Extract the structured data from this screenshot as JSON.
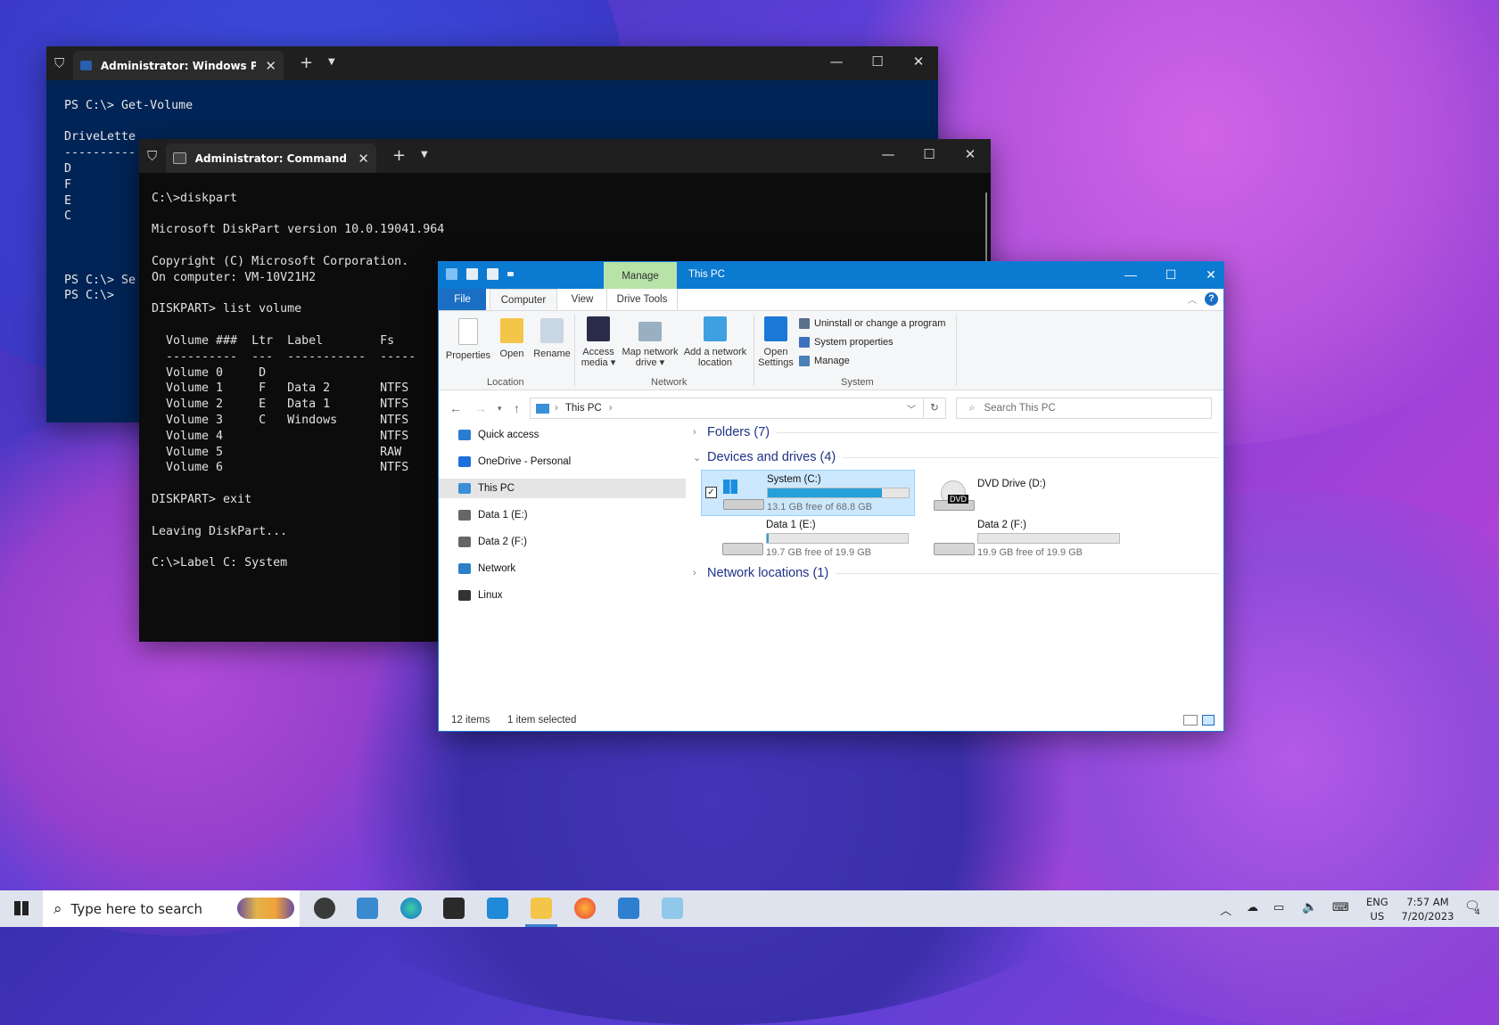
{
  "powershell": {
    "tab_title": "Administrator: Windows Powe",
    "lines": [
      "",
      "PS C:\\> Get-Volume",
      "",
      "DriveLette",
      "----------",
      "D",
      "F",
      "E",
      "C",
      "",
      "",
      "",
      "PS C:\\> Se",
      "PS C:\\>"
    ]
  },
  "cmd": {
    "tab_title": "Administrator: Command Pror",
    "lines": [
      "",
      "C:\\>diskpart",
      "",
      "Microsoft DiskPart version 10.0.19041.964",
      "",
      "Copyright (C) Microsoft Corporation.",
      "On computer: VM-10V21H2",
      "",
      "DISKPART> list volume",
      "",
      "  Volume ###  Ltr  Label        Fs",
      "  ----------  ---  -----------  -----",
      "  Volume 0     D",
      "  Volume 1     F   Data 2       NTFS",
      "  Volume 2     E   Data 1       NTFS",
      "  Volume 3     C   Windows      NTFS",
      "  Volume 4                      NTFS",
      "  Volume 5                      RAW",
      "  Volume 6                      NTFS",
      "",
      "DISKPART> exit",
      "",
      "Leaving DiskPart...",
      "",
      "C:\\>Label C: System"
    ]
  },
  "explorer": {
    "manage_tab": "Manage",
    "title": "This PC",
    "ribbon_tabs": {
      "file": "File",
      "computer": "Computer",
      "view": "View",
      "drive_tools": "Drive Tools"
    },
    "ribbon": {
      "properties": "Properties",
      "open": "Open",
      "rename": "Rename",
      "access_media_1": "Access",
      "access_media_2": "media ▾",
      "map_drive_1": "Map network",
      "map_drive_2": "drive ▾",
      "add_location_1": "Add a network",
      "add_location_2": "location",
      "open_settings_1": "Open",
      "open_settings_2": "Settings",
      "uninstall": "Uninstall or change a program",
      "system_properties": "System properties",
      "manage": "Manage",
      "group_location": "Location",
      "group_network": "Network",
      "group_system": "System"
    },
    "address": {
      "path": "This PC",
      "search_placeholder": "Search This PC"
    },
    "nav": [
      {
        "label": "Quick access",
        "color": "#2b7cd3"
      },
      {
        "label": "OneDrive - Personal",
        "color": "#1e6fd9"
      },
      {
        "label": "This PC",
        "color": "#3a8fd8"
      },
      {
        "label": "Data 1 (E:)",
        "color": "#666666"
      },
      {
        "label": "Data 2 (F:)",
        "color": "#666666"
      },
      {
        "label": "Network",
        "color": "#2d7fc9"
      },
      {
        "label": "Linux",
        "color": "#333333"
      }
    ],
    "groups": {
      "folders": "Folders (7)",
      "devices": "Devices and drives (4)",
      "network": "Network locations (1)"
    },
    "drives": [
      {
        "name": "System (C:)",
        "free": "13.1 GB free of 68.8 GB",
        "used_fraction": 0.81
      },
      {
        "name": "DVD Drive (D:)",
        "free": "",
        "used_fraction": null
      },
      {
        "name": "Data 1 (E:)",
        "free": "19.7 GB free of 19.9 GB",
        "used_fraction": 0.01
      },
      {
        "name": "Data 2 (F:)",
        "free": "19.9 GB free of 19.9 GB",
        "used_fraction": 0.0
      }
    ],
    "dvd_badge": "DVD",
    "status": {
      "items": "12 items",
      "selected": "1 item selected"
    }
  },
  "taskbar": {
    "search_placeholder": "Type here to search",
    "lang_1": "ENG",
    "lang_2": "US",
    "time": "7:57 AM",
    "date": "7/20/2023",
    "notif_count": "4"
  }
}
